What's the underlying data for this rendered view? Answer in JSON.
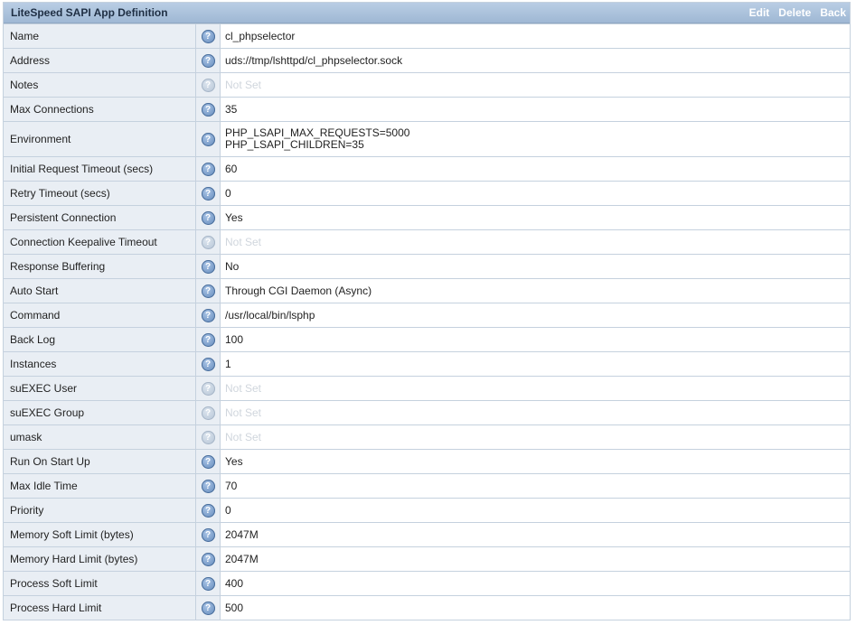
{
  "panel": {
    "title": "LiteSpeed SAPI App Definition",
    "actions": [
      "Edit",
      "Delete",
      "Back"
    ]
  },
  "help_icon_glyph": "?",
  "rows": [
    {
      "label": "Name",
      "value": "cl_phpselector",
      "notset": false
    },
    {
      "label": "Address",
      "value": "uds://tmp/lshttpd/cl_phpselector.sock",
      "notset": false
    },
    {
      "label": "Notes",
      "value": "Not Set",
      "notset": true
    },
    {
      "label": "Max Connections",
      "value": "35",
      "notset": false
    },
    {
      "label": "Environment",
      "value": "PHP_LSAPI_MAX_REQUESTS=5000",
      "value2": "PHP_LSAPI_CHILDREN=35",
      "notset": false
    },
    {
      "label": "Initial Request Timeout (secs)",
      "value": "60",
      "notset": false
    },
    {
      "label": "Retry Timeout (secs)",
      "value": "0",
      "notset": false
    },
    {
      "label": "Persistent Connection",
      "value": "Yes",
      "notset": false
    },
    {
      "label": "Connection Keepalive Timeout",
      "value": "Not Set",
      "notset": true
    },
    {
      "label": "Response Buffering",
      "value": "No",
      "notset": false
    },
    {
      "label": "Auto Start",
      "value": "Through CGI Daemon (Async)",
      "notset": false
    },
    {
      "label": "Command",
      "value": "/usr/local/bin/lsphp",
      "notset": false
    },
    {
      "label": "Back Log",
      "value": "100",
      "notset": false
    },
    {
      "label": "Instances",
      "value": "1",
      "notset": false
    },
    {
      "label": "suEXEC User",
      "value": "Not Set",
      "notset": true
    },
    {
      "label": "suEXEC Group",
      "value": "Not Set",
      "notset": true
    },
    {
      "label": "umask",
      "value": "Not Set",
      "notset": true
    },
    {
      "label": "Run On Start Up",
      "value": "Yes",
      "notset": false
    },
    {
      "label": "Max Idle Time",
      "value": "70",
      "notset": false
    },
    {
      "label": "Priority",
      "value": "0",
      "notset": false
    },
    {
      "label": "Memory Soft Limit (bytes)",
      "value": "2047M",
      "notset": false
    },
    {
      "label": "Memory Hard Limit (bytes)",
      "value": "2047M",
      "notset": false
    },
    {
      "label": "Process Soft Limit",
      "value": "400",
      "notset": false
    },
    {
      "label": "Process Hard Limit",
      "value": "500",
      "notset": false
    }
  ]
}
